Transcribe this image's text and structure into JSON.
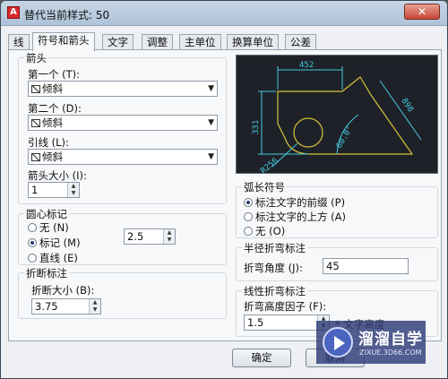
{
  "window": {
    "title": "替代当前样式: 50",
    "close_label": "✕",
    "app_icon": "A"
  },
  "tabs": [
    {
      "label": "线",
      "active": false
    },
    {
      "label": "符号和箭头",
      "active": true
    },
    {
      "label": "文字",
      "active": false
    },
    {
      "label": "调整",
      "active": false
    },
    {
      "label": "主单位",
      "active": false
    },
    {
      "label": "换算单位",
      "active": false
    },
    {
      "label": "公差",
      "active": false
    }
  ],
  "arrowheads": {
    "title": "箭头",
    "first_label": "第一个 (T):",
    "first_value": "倾斜",
    "second_label": "第二个 (D):",
    "second_value": "倾斜",
    "leader_label": "引线 (L):",
    "leader_value": "倾斜",
    "size_label": "箭头大小 (I):",
    "size_value": "1"
  },
  "center_marks": {
    "title": "圆心标记",
    "options": [
      "无 (N)",
      "标记 (M)",
      "直线 (E)"
    ],
    "selected": 1,
    "size_value": "2.5"
  },
  "dim_break": {
    "title": "折断标注",
    "size_label": "折断大小 (B):",
    "size_value": "3.75"
  },
  "arc_length_symbol": {
    "title": "弧长符号",
    "options": [
      "标注文字的前缀 (P)",
      "标注文字的上方 (A)",
      "无 (O)"
    ],
    "selected": 0
  },
  "radius_jog": {
    "title": "半径折弯标注",
    "angle_label": "折弯角度 (J):",
    "angle_value": "45"
  },
  "linear_jog": {
    "title": "线性折弯标注",
    "height_label": "折弯高度因子 (F):",
    "height_value": "1.5",
    "suffix_label": "* 文字高度"
  },
  "preview": {
    "dim_top": "452",
    "dim_left": "331",
    "dim_slant": "898",
    "dim_angle": "60.0°",
    "dim_radius": "R256",
    "line_color": "#d4c23a",
    "dim_color": "#46c8e0"
  },
  "buttons": {
    "ok": "确定",
    "cancel": "取消"
  },
  "watermark": {
    "title": "溜溜自学",
    "subtitle": "ZIXUE.3D66.COM"
  }
}
